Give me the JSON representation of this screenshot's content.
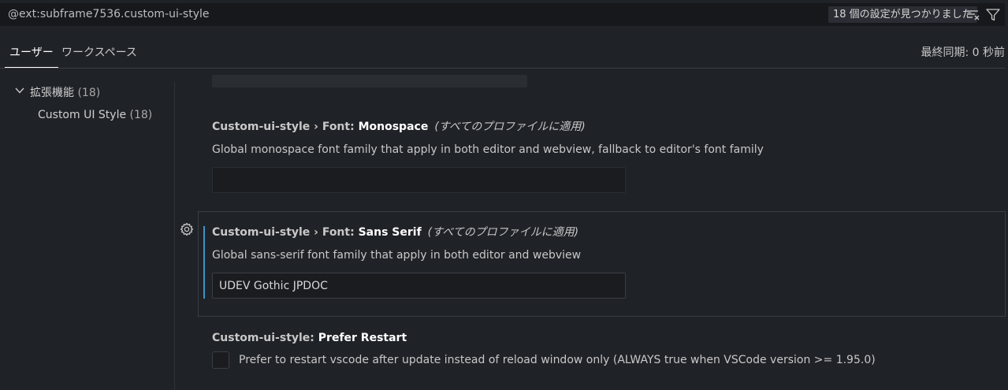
{
  "search": {
    "value": "@ext:subframe7536.custom-ui-style",
    "result_count": "18 個の設定が見つかりました",
    "icons": [
      "clear-filter-icon",
      "filter-icon"
    ]
  },
  "tabs": [
    {
      "label": "ユーザー",
      "active": true
    },
    {
      "label": "ワークスペース",
      "active": false
    }
  ],
  "last_sync": "最終同期: 0 秒前",
  "toc": {
    "group": {
      "label": "拡張機能",
      "count": "(18)"
    },
    "items": [
      {
        "label": "Custom UI Style",
        "count": "(18)"
      }
    ]
  },
  "settings": [
    {
      "category": "Custom-ui-style › Font: ",
      "key": "Monospace",
      "scope": "(すべてのプロファイルに適用)",
      "description": "Global monospace font family that apply in both editor and webview, fallback to editor's font family",
      "value": ""
    },
    {
      "category": "Custom-ui-style › Font: ",
      "key": "Sans Serif",
      "scope": "(すべてのプロファイルに適用)",
      "description": "Global sans-serif font family that apply in both editor and webview",
      "value": "UDEV Gothic JPDOC"
    },
    {
      "category": "Custom-ui-style: ",
      "key": "Prefer Restart",
      "description": "Prefer to restart vscode after update instead of reload window only (ALWAYS true when VSCode version >= 1.95.0)",
      "checked": false
    }
  ],
  "colors": {
    "background": "#1f2227",
    "accent": "#3c96c8"
  }
}
